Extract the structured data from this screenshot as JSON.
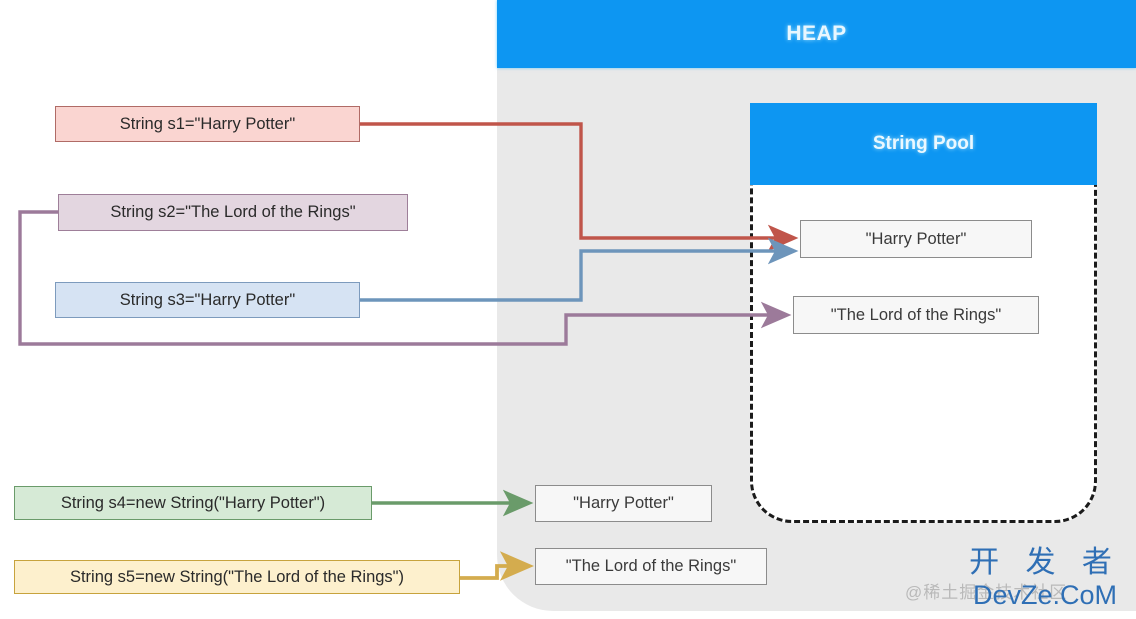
{
  "heap": {
    "title": "HEAP",
    "background_color": "#e9e9e9",
    "header_color": "#0d96f2",
    "items": [
      {
        "id": "heap-hp",
        "label": "\"Harry Potter\""
      },
      {
        "id": "heap-lotr",
        "label": "\"The Lord of the Rings\""
      }
    ]
  },
  "string_pool": {
    "title": "String Pool",
    "header_color": "#0d96f2",
    "border_style": "dashed",
    "items": [
      {
        "id": "pool-hp",
        "label": "\"Harry Potter\""
      },
      {
        "id": "pool-lotr",
        "label": "\"The Lord of the Rings\""
      }
    ]
  },
  "variables": [
    {
      "id": "s1",
      "label": "String s1=\"Harry Potter\"",
      "fill": "#fad5d1",
      "stroke": "#b06b66",
      "arrow_color": "#c0554a",
      "target": "pool-hp"
    },
    {
      "id": "s2",
      "label": "String s2=\"The Lord of the Rings\"",
      "fill": "#e3d6e0",
      "stroke": "#9e7f99",
      "arrow_color": "#9c7a9a",
      "target": "pool-lotr"
    },
    {
      "id": "s3",
      "label": "String s3=\"Harry Potter\"",
      "fill": "#d6e3f3",
      "stroke": "#7d9bbd",
      "arrow_color": "#6d95bb",
      "target": "pool-hp"
    },
    {
      "id": "s4",
      "label": "String s4=new String(\"Harry Potter\")",
      "fill": "#d6ead6",
      "stroke": "#6a9b6a",
      "arrow_color": "#6a9b6a",
      "target": "heap-hp"
    },
    {
      "id": "s5",
      "label": "String s5=new String(\"The Lord of the Rings\")",
      "fill": "#fdf0cd",
      "stroke": "#c7a33d",
      "arrow_color": "#d4ac4e",
      "target": "heap-lotr"
    }
  ],
  "watermark": {
    "chinese_handle": "@稀土掘金技术社区",
    "brand_cn": "开 发 者",
    "brand_en": "DevZe.CoM",
    "brand_color": "#2f6fb5"
  }
}
